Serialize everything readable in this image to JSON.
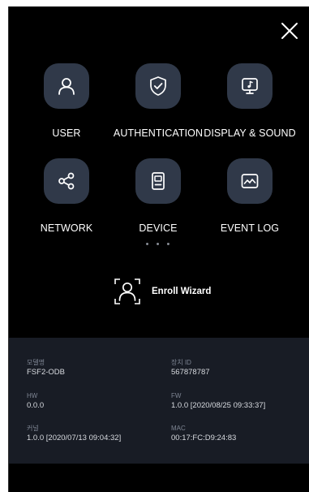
{
  "header": {
    "close_icon": "close-icon"
  },
  "menu": {
    "user": {
      "label": "USER",
      "icon": "user-icon"
    },
    "authentication": {
      "label": "AUTHENTICATION",
      "icon": "shield-check-icon"
    },
    "display_sound": {
      "label": "DISPLAY & SOUND",
      "icon": "display-sound-icon"
    },
    "network": {
      "label": "NETWORK",
      "icon": "share-icon"
    },
    "device": {
      "label": "DEVICE",
      "icon": "device-icon"
    },
    "event_log": {
      "label": "EVENT LOG",
      "icon": "event-log-icon"
    }
  },
  "more_indicator": "• • •",
  "enroll_wizard": {
    "label": "Enroll Wizard",
    "icon": "face-scan-icon"
  },
  "info": {
    "model": {
      "key": "모델명",
      "value": "FSF2-ODB"
    },
    "device_id": {
      "key": "장치 ID",
      "value": "567878787"
    },
    "hw": {
      "key": "HW",
      "value": "0.0.0"
    },
    "fw": {
      "key": "FW",
      "value": "1.0.0 [2020/08/25 09:33:37]"
    },
    "kernel": {
      "key": "커널",
      "value": "1.0.0 [2020/07/13 09:04:32]"
    },
    "mac": {
      "key": "MAC",
      "value": "00:17:FC:D9:24:83"
    }
  },
  "colors": {
    "background": "#000000",
    "tile": "#303949",
    "info_panel": "#181c25",
    "icon_stroke": "#ffffff"
  }
}
